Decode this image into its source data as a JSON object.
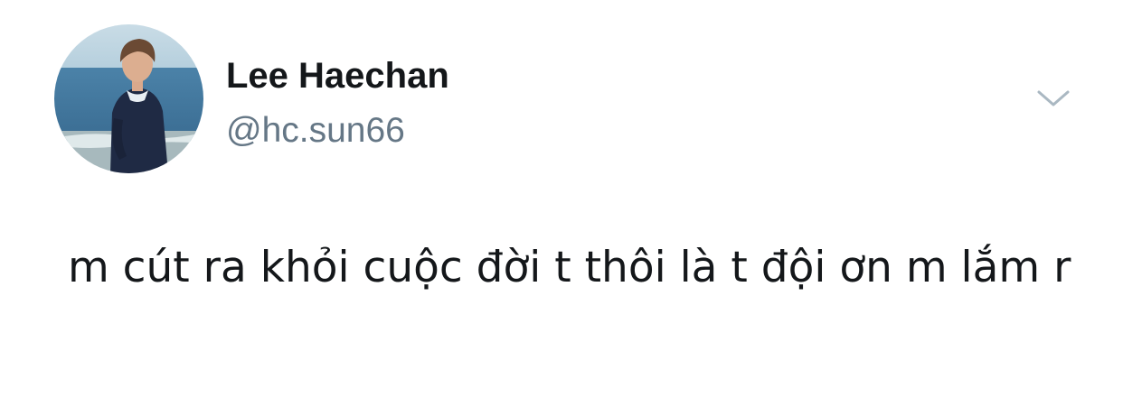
{
  "tweet": {
    "author": {
      "display_name": "Lee Haechan",
      "handle": "@hc.sun66",
      "avatar_icon": "profile-photo"
    },
    "menu_icon": "chevron-down-icon",
    "text": " m cút ra khỏi cuộc đời t thôi là t đội ơn m lắm r"
  },
  "colors": {
    "background": "#ffffff",
    "text_primary": "#14171a",
    "text_secondary": "#657786",
    "caret": "#aab8c2"
  }
}
